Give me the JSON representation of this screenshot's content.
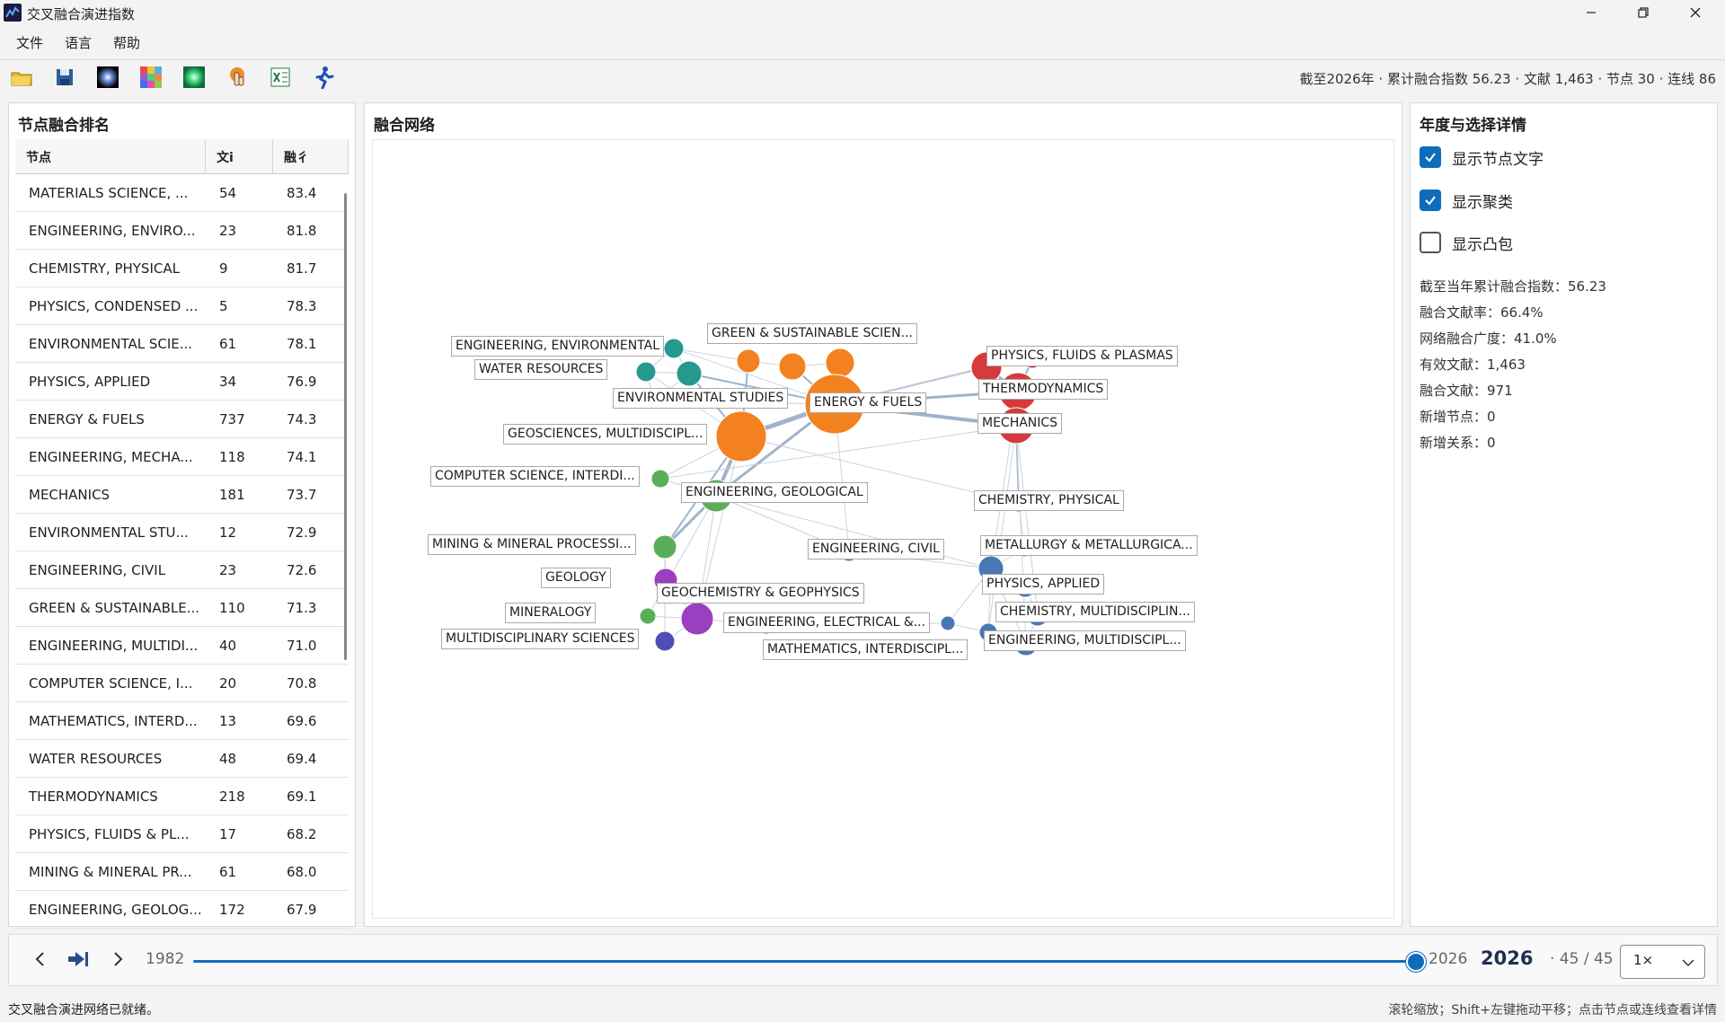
{
  "window": {
    "title": "交叉融合演进指数",
    "minimize_icon": "minimize-icon",
    "restore_icon": "restore-icon",
    "close_icon": "close-icon"
  },
  "menu": {
    "file": "文件",
    "language": "语言",
    "help": "帮助"
  },
  "toolbar": {
    "buttons": [
      "open-folder-icon",
      "save-icon",
      "glow-black-icon",
      "color-grid-icon",
      "glow-green-icon",
      "hand-pointer-icon",
      "excel-icon",
      "runner-icon"
    ],
    "summary": "截至2026年 · 累计融合指数 56.23 · 文献 1,463 · 节点 30 · 连线 86"
  },
  "left_panel": {
    "title": "节点融合排名",
    "columns": [
      "节点",
      "文i",
      "融彳"
    ],
    "rows": [
      [
        "MATERIALS SCIENCE, ...",
        "54",
        "83.4"
      ],
      [
        "ENGINEERING, ENVIRO...",
        "23",
        "81.8"
      ],
      [
        "CHEMISTRY, PHYSICAL",
        "9",
        "81.7"
      ],
      [
        "PHYSICS, CONDENSED ...",
        "5",
        "78.3"
      ],
      [
        "ENVIRONMENTAL SCIE...",
        "61",
        "78.1"
      ],
      [
        "PHYSICS, APPLIED",
        "34",
        "76.9"
      ],
      [
        "ENERGY & FUELS",
        "737",
        "74.3"
      ],
      [
        "ENGINEERING, MECHA...",
        "118",
        "74.1"
      ],
      [
        "MECHANICS",
        "181",
        "73.7"
      ],
      [
        "ENVIRONMENTAL STU...",
        "12",
        "72.9"
      ],
      [
        "ENGINEERING, CIVIL",
        "23",
        "72.6"
      ],
      [
        "GREEN & SUSTAINABLE...",
        "110",
        "71.3"
      ],
      [
        "ENGINEERING, MULTIDI...",
        "40",
        "71.0"
      ],
      [
        "COMPUTER SCIENCE, I...",
        "20",
        "70.8"
      ],
      [
        "MATHEMATICS, INTERD...",
        "13",
        "69.6"
      ],
      [
        "WATER RESOURCES",
        "48",
        "69.4"
      ],
      [
        "THERMODYNAMICS",
        "218",
        "69.1"
      ],
      [
        "PHYSICS, FLUIDS & PL...",
        "17",
        "68.2"
      ],
      [
        "MINING & MINERAL PR...",
        "61",
        "68.0"
      ],
      [
        "ENGINEERING, GEOLOG...",
        "172",
        "67.9"
      ]
    ]
  },
  "center_panel": {
    "title": "融合网络",
    "cluster_colors": {
      "teal": "#26998f",
      "orange": "#f48120",
      "red": "#d73a3a",
      "green": "#5aae5a",
      "purple": "#9a3fbf",
      "blue": "#4877b5",
      "indigo": "#4f4eb6"
    },
    "labels": [
      "ENGINEERING, ENVIRONMENTAL",
      "WATER RESOURCES",
      "ENVIRONMENTAL STUDIES",
      "GREEN & SUSTAINABLE SCIEN...",
      "ENERGY & FUELS",
      "GEOSCIENCES, MULTIDISCIPL...",
      "COMPUTER SCIENCE, INTERDI...",
      "ENGINEERING, GEOLOGICAL",
      "MINING & MINERAL PROCESSI...",
      "GEOLOGY",
      "GEOCHEMISTRY & GEOPHYSICS",
      "MINERALOGY",
      "MULTIDISCIPLINARY SCIENCES",
      "ENGINEERING, ELECTRICAL &...",
      "MATHEMATICS, INTERDISCIPL...",
      "ENGINEERING, CIVIL",
      "PHYSICS, FLUIDS & PLASMAS",
      "THERMODYNAMICS",
      "MECHANICS",
      "CHEMISTRY, PHYSICAL",
      "METALLURGY & METALLURGICA...",
      "PHYSICS, APPLIED",
      "CHEMISTRY, MULTIDISCIPLIN...",
      "ENGINEERING, MULTIDISCIPL..."
    ]
  },
  "right_panel": {
    "title": "年度与选择详情",
    "checkboxes": [
      {
        "label": "显示节点文字",
        "checked": true
      },
      {
        "label": "显示聚类",
        "checked": true
      },
      {
        "label": "显示凸包",
        "checked": false
      }
    ],
    "stats": [
      "截至当年累计融合指数：56.23",
      "融合文献率：66.4%",
      "网络融合广度：41.0%",
      "有效文献：1,463",
      "融合文献：971",
      "新增节点：0",
      "新增关系：0"
    ]
  },
  "timeline": {
    "start_year": "1982",
    "end_year": "2026",
    "current_year": "2026",
    "position": "· 45 / 45",
    "progress": 1.0,
    "speed": "1×"
  },
  "status": {
    "left": "交叉融合演进网络已就绪。",
    "right": "滚轮缩放；Shift+左键拖动平移；点击节点或连线查看详情"
  }
}
